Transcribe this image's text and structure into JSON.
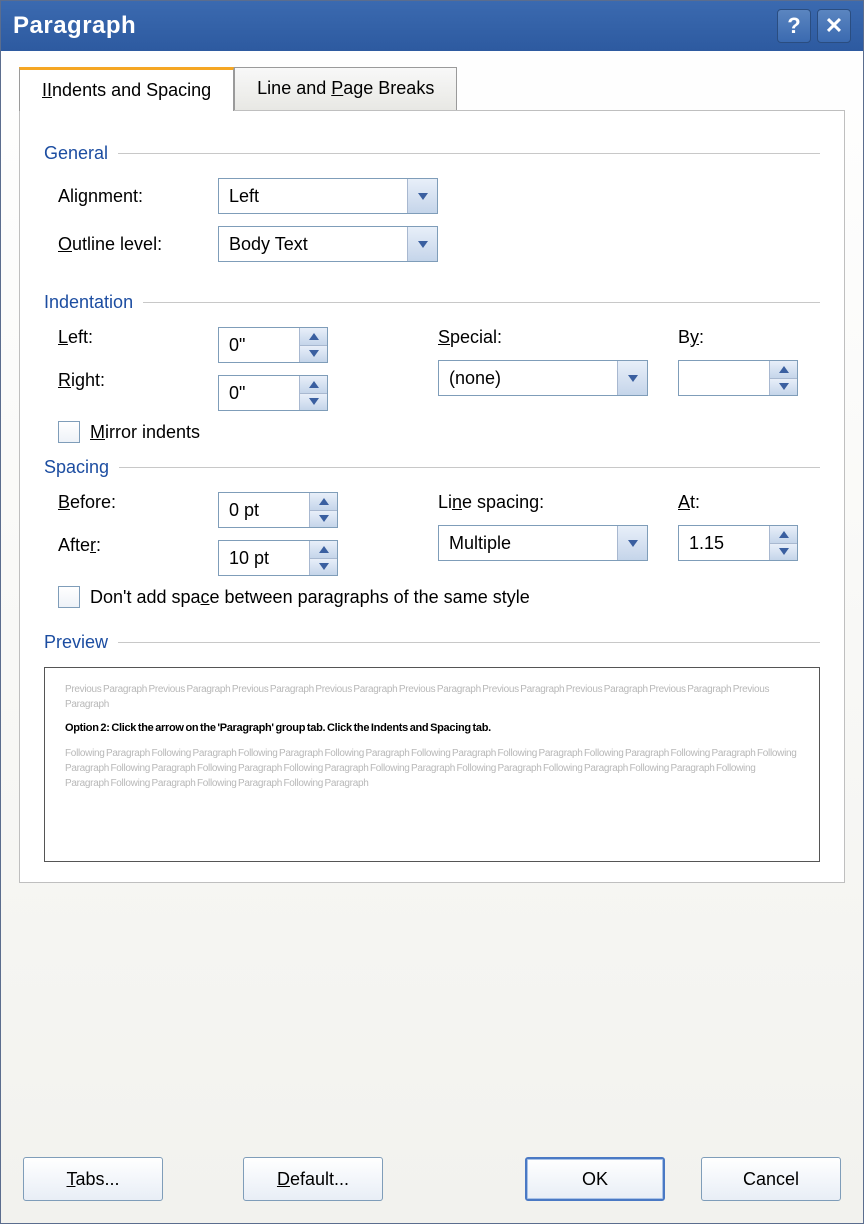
{
  "title": "Paragraph",
  "tabs": {
    "indents": "Indents and Spacing",
    "breaks_prefix": "Line and ",
    "breaks_u": "P",
    "breaks_suffix": "age Breaks"
  },
  "general": {
    "head": "General",
    "alignment_label": "Alignment:",
    "alignment_value": "Left",
    "outline_u": "O",
    "outline_label": "utline level:",
    "outline_value": "Body Text"
  },
  "indentation": {
    "head": "Indentation",
    "left_u": "L",
    "left_label": "eft:",
    "left_value": "0\"",
    "right_u": "R",
    "right_label": "ight:",
    "right_value": "0\"",
    "special_u": "S",
    "special_label": "pecial:",
    "special_value": "(none)",
    "by_u": "y",
    "by_prefix": "B",
    "by_label": ":",
    "by_value": "",
    "mirror_u": "M",
    "mirror_label": "irror indents"
  },
  "spacing": {
    "head": "Spacing",
    "before_u": "B",
    "before_label": "efore:",
    "before_value": "0 pt",
    "after_u": "r",
    "after_prefix": "Afte",
    "after_suffix": ":",
    "after_value": "10 pt",
    "line_u": "n",
    "line_prefix": "Li",
    "line_suffix": "e spacing:",
    "line_value": "Multiple",
    "at_u": "A",
    "at_label": "t:",
    "at_value": "1.15",
    "noadd_prefix": "Don't add spa",
    "noadd_u": "c",
    "noadd_suffix": "e between paragraphs of the same style"
  },
  "preview": {
    "head": "Preview",
    "before_text": "Previous Paragraph Previous Paragraph Previous Paragraph Previous Paragraph Previous Paragraph Previous Paragraph Previous Paragraph Previous Paragraph Previous Paragraph",
    "main_text": "Option 2: Click the arrow on the 'Paragraph' group tab. Click the Indents and Spacing tab.",
    "after_text": "Following Paragraph Following Paragraph Following Paragraph Following Paragraph Following Paragraph Following Paragraph Following Paragraph Following Paragraph Following Paragraph Following Paragraph Following Paragraph Following Paragraph Following Paragraph Following Paragraph Following Paragraph Following Paragraph Following Paragraph Following Paragraph Following Paragraph Following Paragraph"
  },
  "buttons": {
    "tabs_u": "T",
    "tabs_label": "abs...",
    "default_u": "D",
    "default_label": "efault...",
    "ok": "OK",
    "cancel": "Cancel"
  }
}
